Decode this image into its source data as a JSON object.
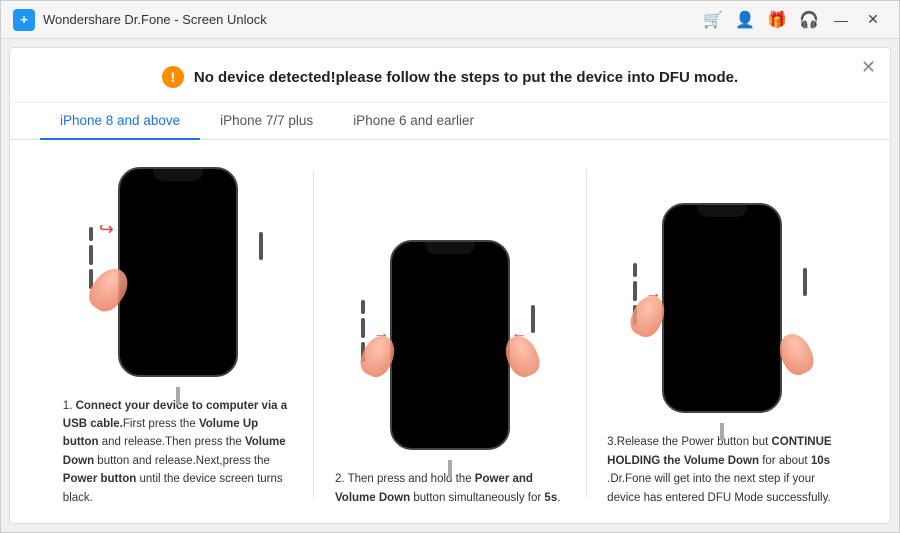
{
  "window": {
    "title": "Wondershare Dr.Fone - Screen Unlock",
    "logo": "+"
  },
  "titlebar_icons": {
    "cart": "🛒",
    "user": "👤",
    "gift": "🎁",
    "headset": "🎧"
  },
  "window_controls": {
    "minimize": "—",
    "close": "✕"
  },
  "notice": {
    "icon": "!",
    "text": "No device detected!please follow the steps to put the device into DFU mode."
  },
  "modal_close": "✕",
  "tabs": [
    {
      "id": "tab-iphone8",
      "label": "iPhone 8 and above",
      "active": true
    },
    {
      "id": "tab-iphone7",
      "label": "iPhone 7/7 plus",
      "active": false
    },
    {
      "id": "tab-iphone6",
      "label": "iPhone 6 and earlier",
      "active": false
    }
  ],
  "steps": [
    {
      "num": "1.",
      "bold_start": "Connect your device to computer via a USB cable.",
      "rest": "First press the ",
      "b1": "Volume Up button",
      "t1": " and release.Then press the ",
      "b2": "Volume Down",
      "t2": " button and release.Next,press the ",
      "b3": "Power button",
      "t3": " until the device screen turns black."
    },
    {
      "num": "2.",
      "text_pre": "Then press and hold the ",
      "b1": "Power and Volume Down",
      "text_mid": " button simultaneously for ",
      "b2": "5s",
      "text_end": "."
    },
    {
      "num": "3.",
      "text_pre": "Release the Power button but ",
      "b1": "CONTINUE HOLDING the Volume Down",
      "text_mid": " for about ",
      "b2": "10s",
      "text_end": " .Dr.Fone will get into the next step if your device has entered DFU Mode successfully."
    }
  ]
}
